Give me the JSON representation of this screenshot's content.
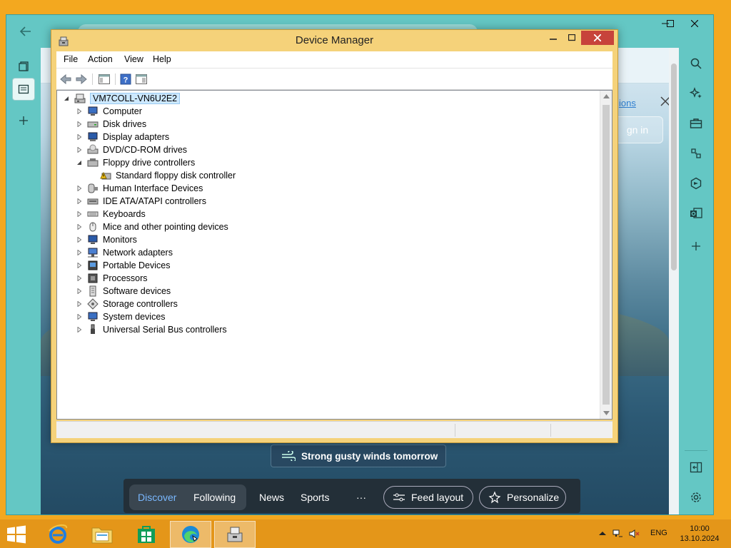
{
  "edge": {
    "signin_label": "gn in",
    "strip_link": "ions",
    "weather_text": "Strong gusty winds tomorrow",
    "news_nav": {
      "discover": "Discover",
      "following": "Following",
      "news": "News",
      "sports": "Sports",
      "more": "···",
      "feed_layout": "Feed layout",
      "personalize": "Personalize"
    }
  },
  "device_manager": {
    "title": "Device Manager",
    "menu": [
      "File",
      "Action",
      "View",
      "Help"
    ],
    "root": "VM7COLL-VN6U2E2",
    "tree": [
      {
        "label": "Computer",
        "icon": "computer-icon",
        "expanded": false
      },
      {
        "label": "Disk drives",
        "icon": "disk-drive-icon",
        "expanded": false
      },
      {
        "label": "Display adapters",
        "icon": "display-adapter-icon",
        "expanded": false
      },
      {
        "label": "DVD/CD-ROM drives",
        "icon": "dvd-drive-icon",
        "expanded": false
      },
      {
        "label": "Floppy drive controllers",
        "icon": "floppy-controller-icon",
        "expanded": true
      },
      {
        "label": "Standard floppy disk controller",
        "icon": "warning-device-icon",
        "child": true
      },
      {
        "label": "Human Interface Devices",
        "icon": "hid-icon",
        "expanded": false
      },
      {
        "label": "IDE ATA/ATAPI controllers",
        "icon": "ide-controller-icon",
        "expanded": false
      },
      {
        "label": "Keyboards",
        "icon": "keyboard-icon",
        "expanded": false
      },
      {
        "label": "Mice and other pointing devices",
        "icon": "mouse-icon",
        "expanded": false
      },
      {
        "label": "Monitors",
        "icon": "monitor-icon",
        "expanded": false
      },
      {
        "label": "Network adapters",
        "icon": "network-adapter-icon",
        "expanded": false
      },
      {
        "label": "Portable Devices",
        "icon": "portable-device-icon",
        "expanded": false
      },
      {
        "label": "Processors",
        "icon": "processor-icon",
        "expanded": false
      },
      {
        "label": "Software devices",
        "icon": "software-device-icon",
        "expanded": false
      },
      {
        "label": "Storage controllers",
        "icon": "storage-controller-icon",
        "expanded": false
      },
      {
        "label": "System devices",
        "icon": "system-device-icon",
        "expanded": false
      },
      {
        "label": "Universal Serial Bus controllers",
        "icon": "usb-icon",
        "expanded": false
      }
    ]
  },
  "taskbar": {
    "language": "ENG",
    "time": "10:00",
    "date": "13.10.2024"
  },
  "colors": {
    "desktop": "#f3a81f",
    "taskbar": "#e49619",
    "edge_chrome": "#64c7c4",
    "dm_frame": "#f5d27a",
    "close_red": "#c7433b",
    "discover_blue": "#7ab8ff"
  }
}
